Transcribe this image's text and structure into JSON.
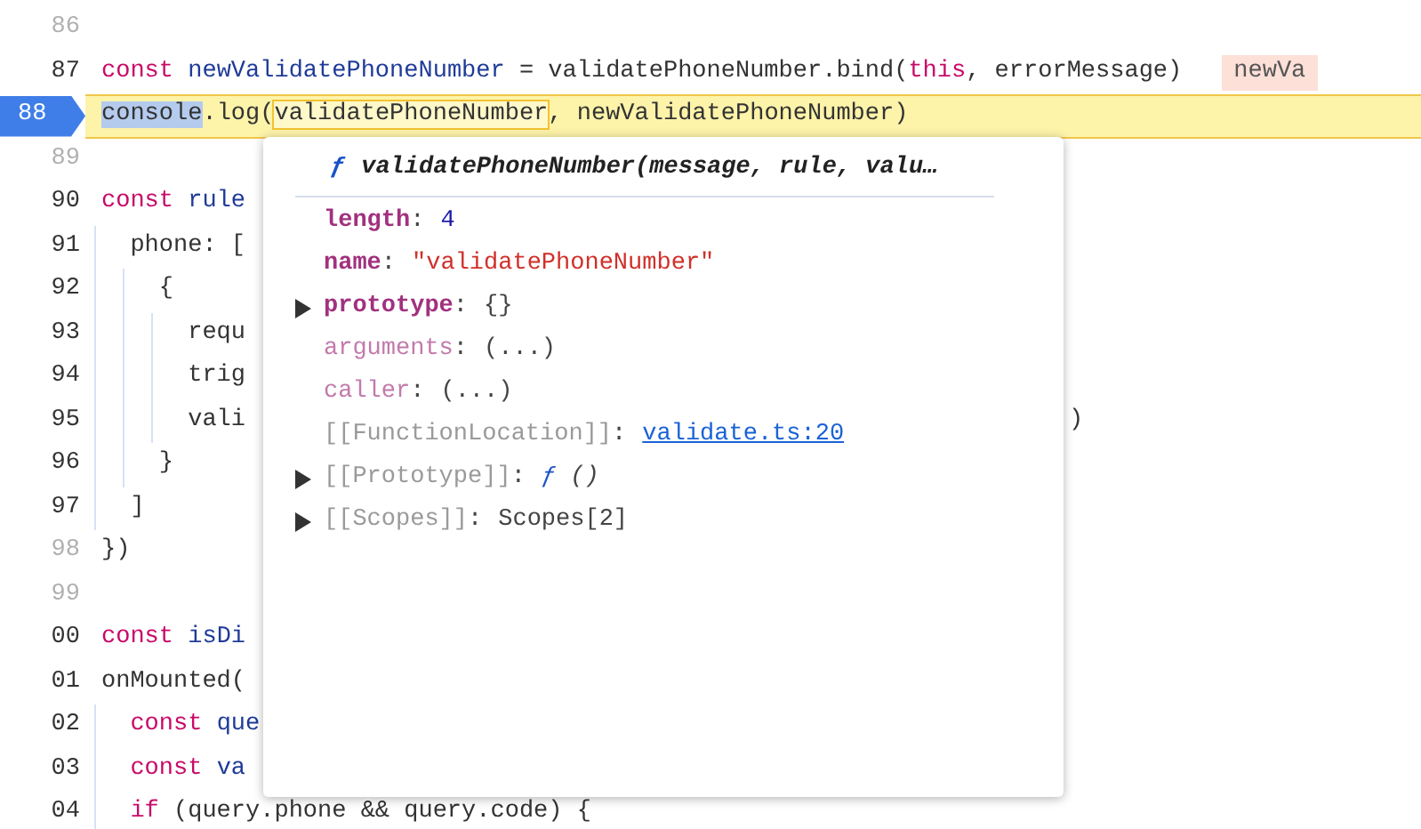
{
  "code_lines": [
    {
      "number": "86",
      "breakable": false,
      "paused": false
    },
    {
      "number": "87",
      "breakable": true,
      "paused": false,
      "segments": [
        {
          "kind": "keyword",
          "text": "const"
        },
        {
          "kind": "def",
          "text": " newValidatePhoneNumber"
        },
        {
          "kind": "plain",
          "text": " = validatePhoneNumber.bind("
        },
        {
          "kind": "keyword",
          "text": "this"
        },
        {
          "kind": "plain",
          "text": ", errorMessage)"
        }
      ],
      "inline_value": "newVa"
    },
    {
      "number": "88",
      "breakable": true,
      "paused": true,
      "segments": [
        {
          "kind": "selected",
          "text": "console"
        },
        {
          "kind": "plain",
          "text": ".log("
        },
        {
          "kind": "hovered",
          "text": "validatePhoneNumber"
        },
        {
          "kind": "plain",
          "text": ", newValidatePhoneNumber)"
        }
      ]
    },
    {
      "number": "89",
      "breakable": false,
      "paused": false
    },
    {
      "number": "90",
      "breakable": true,
      "paused": false,
      "segments": [
        {
          "kind": "keyword",
          "text": "const"
        },
        {
          "kind": "def",
          "text": " rule"
        }
      ]
    },
    {
      "number": "91",
      "breakable": true,
      "paused": false,
      "segments": [
        {
          "kind": "plain",
          "text": "  phone: ["
        }
      ]
    },
    {
      "number": "92",
      "breakable": true,
      "paused": false,
      "segments": [
        {
          "kind": "plain",
          "text": "    {"
        }
      ]
    },
    {
      "number": "93",
      "breakable": true,
      "paused": false,
      "segments": [
        {
          "kind": "plain",
          "text": "      requ"
        }
      ]
    },
    {
      "number": "94",
      "breakable": true,
      "paused": false,
      "segments": [
        {
          "kind": "plain",
          "text": "      trig"
        }
      ]
    },
    {
      "number": "95",
      "breakable": true,
      "paused": false,
      "segments": [
        {
          "kind": "plain",
          "text": "      vali"
        }
      ],
      "tail": ")"
    },
    {
      "number": "96",
      "breakable": true,
      "paused": false,
      "segments": [
        {
          "kind": "plain",
          "text": "    }"
        }
      ]
    },
    {
      "number": "97",
      "breakable": true,
      "paused": false,
      "segments": [
        {
          "kind": "plain",
          "text": "  ]"
        }
      ]
    },
    {
      "number": "98",
      "breakable": false,
      "paused": false,
      "segments": [
        {
          "kind": "plain",
          "text": "})"
        }
      ]
    },
    {
      "number": "99",
      "breakable": false,
      "paused": false
    },
    {
      "number": "00",
      "breakable": true,
      "paused": false,
      "segments": [
        {
          "kind": "keyword",
          "text": "const"
        },
        {
          "kind": "def",
          "text": " isDi"
        }
      ]
    },
    {
      "number": "01",
      "breakable": true,
      "paused": false,
      "segments": [
        {
          "kind": "plain",
          "text": "onMounted("
        }
      ]
    },
    {
      "number": "02",
      "breakable": true,
      "paused": false,
      "segments": [
        {
          "kind": "keyword",
          "text": "  const"
        },
        {
          "kind": "def",
          "text": " que"
        }
      ]
    },
    {
      "number": "03",
      "breakable": true,
      "paused": false,
      "segments": [
        {
          "kind": "keyword",
          "text": "  const"
        },
        {
          "kind": "def",
          "text": " va"
        }
      ]
    },
    {
      "number": "04",
      "breakable": true,
      "paused": false,
      "segments": [
        {
          "kind": "keyword",
          "text": "  if"
        },
        {
          "kind": "plain",
          "text": " (query.phone && query.code) {"
        }
      ]
    }
  ],
  "popover": {
    "function_sign": "ƒ",
    "title": "validatePhoneNumber(message, rule, valu…",
    "properties": [
      {
        "expandable": false,
        "kind": "own",
        "key": "length",
        "separator": ":",
        "value": [
          {
            "kind": "number",
            "text": "4"
          }
        ]
      },
      {
        "expandable": false,
        "kind": "own",
        "key": "name",
        "separator": ":",
        "value": [
          {
            "kind": "string",
            "text": "\"validatePhoneNumber\""
          }
        ]
      },
      {
        "expandable": true,
        "kind": "own",
        "key": "prototype",
        "separator": ":",
        "value": [
          {
            "kind": "plain",
            "text": "{}"
          }
        ]
      },
      {
        "expandable": false,
        "kind": "accessor",
        "key": "arguments",
        "separator": ":",
        "value": [
          {
            "kind": "plain",
            "text": "(...)"
          }
        ]
      },
      {
        "expandable": false,
        "kind": "accessor",
        "key": "caller",
        "separator": ":",
        "value": [
          {
            "kind": "plain",
            "text": "(...)"
          }
        ]
      },
      {
        "expandable": false,
        "kind": "internal",
        "key": "[[FunctionLocation]]",
        "separator": ":",
        "value": [
          {
            "kind": "link",
            "text": "validate.ts:20"
          }
        ]
      },
      {
        "expandable": true,
        "kind": "internal",
        "key": "[[Prototype]]",
        "separator": ":",
        "value": [
          {
            "kind": "function",
            "text": "ƒ"
          },
          {
            "kind": "italic",
            "text": " ()"
          }
        ]
      },
      {
        "expandable": true,
        "kind": "internal",
        "key": "[[Scopes]]",
        "separator": ":",
        "value": [
          {
            "kind": "plain",
            "text": "Scopes[2]"
          }
        ]
      }
    ]
  }
}
